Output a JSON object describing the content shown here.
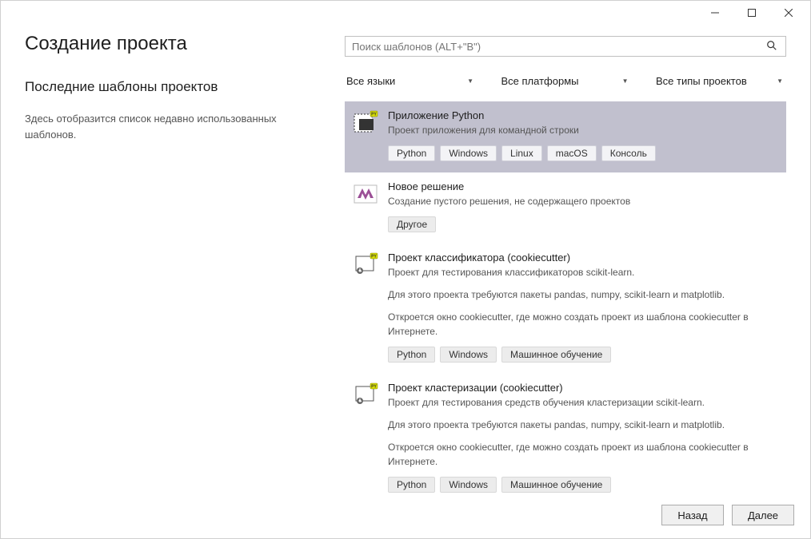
{
  "window": {
    "title_page": "Создание проекта"
  },
  "left": {
    "recent_title": "Последние шаблоны проектов",
    "recent_msg": "Здесь отобразится список недавно использованных шаблонов."
  },
  "search": {
    "placeholder": "Поиск шаблонов (ALT+\"В\")"
  },
  "filters": {
    "language": "Все языки",
    "platform": "Все платформы",
    "type": "Все типы проектов"
  },
  "templates": [
    {
      "selected": true,
      "icon": "python-app",
      "title": "Приложение Python",
      "desc": "Проект приложения для командной строки",
      "extras": [],
      "tags": [
        "Python",
        "Windows",
        "Linux",
        "macOS",
        "Консоль"
      ]
    },
    {
      "selected": false,
      "icon": "vs-solution",
      "title": "Новое решение",
      "desc": "Создание пустого решения, не содержащего проектов",
      "extras": [],
      "tags": [
        "Другое"
      ]
    },
    {
      "selected": false,
      "icon": "python-cookie",
      "title": "Проект классификатора (cookiecutter)",
      "desc": "Проект для тестирования классификаторов scikit-learn.",
      "extras": [
        "Для этого проекта требуются пакеты pandas, numpy, scikit-learn и matplotlib.",
        "Откроется окно cookiecutter, где можно создать проект из шаблона cookiecutter в Интернете."
      ],
      "tags": [
        "Python",
        "Windows",
        "Машинное обучение"
      ]
    },
    {
      "selected": false,
      "icon": "python-cookie",
      "title": "Проект кластеризации (cookiecutter)",
      "desc": "Проект для тестирования средств обучения кластеризации scikit-learn.",
      "extras": [
        "Для этого проекта требуются пакеты pandas, numpy, scikit-learn и matplotlib.",
        "Откроется окно cookiecutter, где можно создать проект из шаблона cookiecutter в Интернете."
      ],
      "tags": [
        "Python",
        "Windows",
        "Машинное обучение"
      ]
    }
  ],
  "footer": {
    "back": "Назад",
    "next": "Далее"
  }
}
